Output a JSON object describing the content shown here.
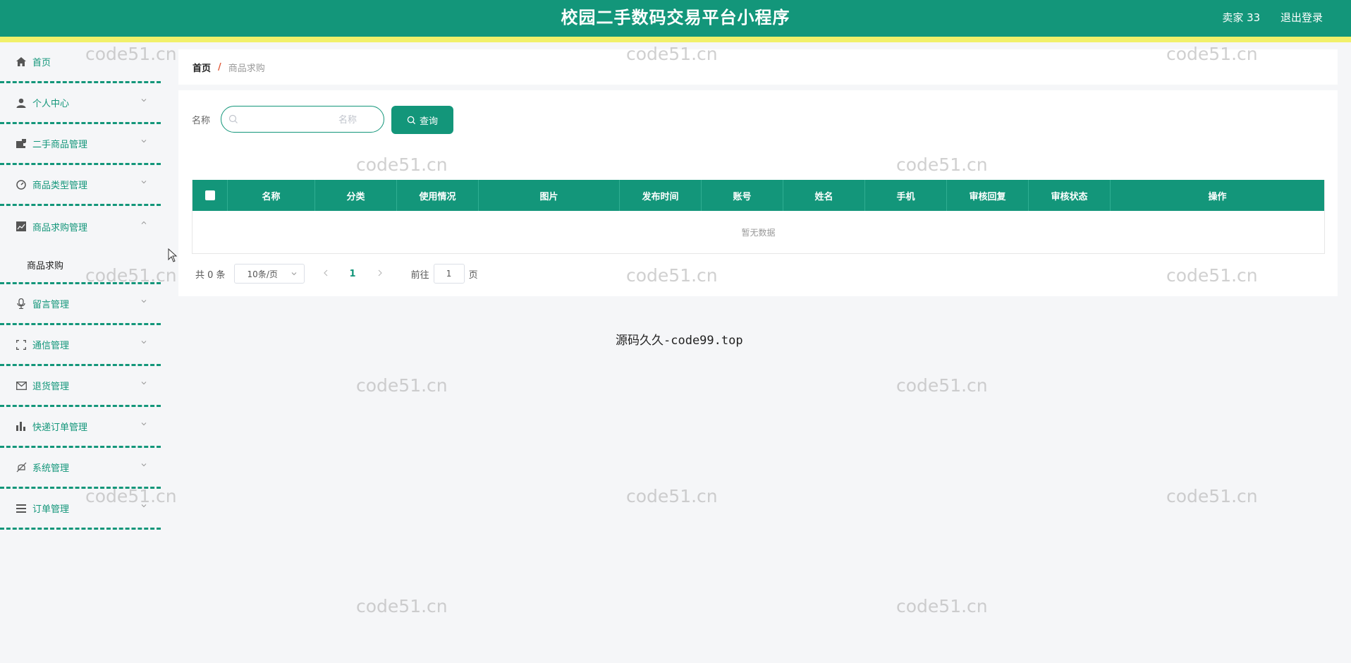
{
  "header": {
    "title": "校园二手数码交易平台小程序",
    "user": "卖家 33",
    "logout": "退出登录"
  },
  "sidebar": {
    "items": [
      {
        "label": "首页",
        "icon": "home-icon"
      },
      {
        "label": "个人中心",
        "icon": "user-icon"
      },
      {
        "label": "二手商品管理",
        "icon": "wallet-icon"
      },
      {
        "label": "商品类型管理",
        "icon": "dashboard-icon"
      },
      {
        "label": "商品求购管理",
        "icon": "chart-icon"
      },
      {
        "label": "留言管理",
        "icon": "microphone-icon"
      },
      {
        "label": "通信管理",
        "icon": "fullscreen-icon"
      },
      {
        "label": "退货管理",
        "icon": "mail-icon"
      },
      {
        "label": "快递订单管理",
        "icon": "bar-chart-icon"
      },
      {
        "label": "系统管理",
        "icon": "bell-off-icon"
      },
      {
        "label": "订单管理",
        "icon": "list-icon"
      }
    ],
    "submenu": {
      "label": "商品求购"
    }
  },
  "breadcrumb": {
    "home": "首页",
    "separator": "/",
    "current": "商品求购"
  },
  "search": {
    "label": "名称",
    "placeholder": "名称",
    "button": "查询"
  },
  "table": {
    "columns": [
      "名称",
      "分类",
      "使用情况",
      "图片",
      "发布时间",
      "账号",
      "姓名",
      "手机",
      "审核回复",
      "审核状态",
      "操作"
    ],
    "empty_text": "暂无数据"
  },
  "pagination": {
    "total": "共 0 条",
    "page_size": "10条/页",
    "current_page": "1",
    "goto_label": "前往",
    "goto_value": "1",
    "page_suffix": "页"
  },
  "watermark": "code51.cn",
  "center_note": "源码久久-code99.top",
  "colors": {
    "primary": "#13967a",
    "accent_strip": "#f1f06a",
    "background": "#f5f6f8"
  }
}
